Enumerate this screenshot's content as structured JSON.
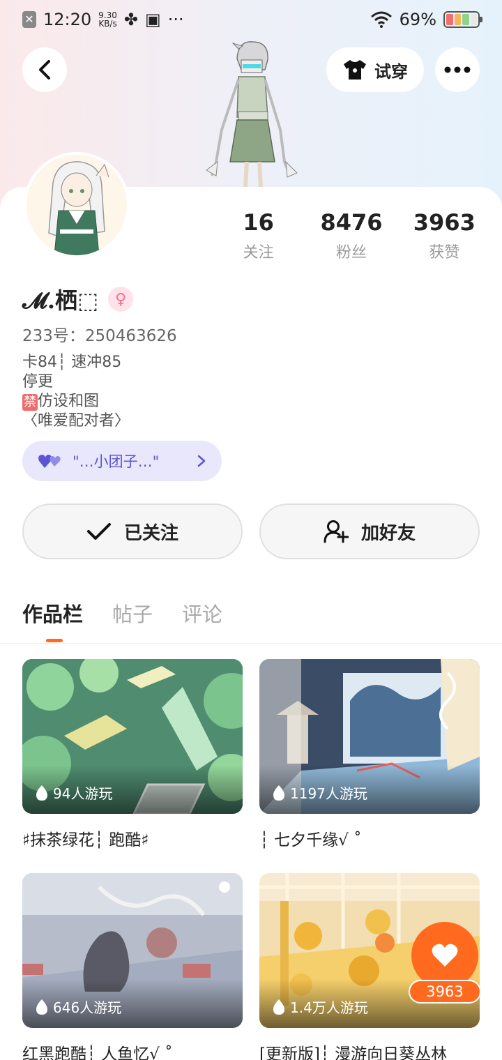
{
  "status_bar": {
    "time": "12:20",
    "net_speed_value": "9.30",
    "net_speed_unit": "KB/s",
    "more": "···",
    "battery": "69%"
  },
  "header": {
    "try_on_label": "试穿"
  },
  "profile": {
    "stats": [
      {
        "value": "16",
        "label": "关注"
      },
      {
        "value": "8476",
        "label": "粉丝"
      },
      {
        "value": "3963",
        "label": "获赞"
      }
    ],
    "username": "𝓜.栖⬚",
    "gender_icon": "♀",
    "uid": "233号：250463626",
    "bio": [
      "卡84┆ 速冲85",
      "停更",
      "仿设和图",
      "〈唯爱配对者〉"
    ],
    "ban_badge": "禁",
    "group_chip": "\"…小团子…\""
  },
  "actions": {
    "followed_label": "已关注",
    "add_friend_label": "加好友"
  },
  "tabs": [
    {
      "label": "作品栏",
      "active": true
    },
    {
      "label": "帖子",
      "active": false
    },
    {
      "label": "评论",
      "active": false
    }
  ],
  "works": [
    {
      "plays": "94人游玩",
      "title": "♯抹茶绿花┆ 跑酷♯"
    },
    {
      "plays": "1197人游玩",
      "title": "┆ 七夕千缘√ ˚"
    },
    {
      "plays": "646人游玩",
      "title": "红黑跑酷┆ 人鱼忆√ ˚"
    },
    {
      "plays": "1.4万人游玩",
      "title": "[更新版]┆ 漫游向日葵丛林"
    }
  ],
  "like_count": "3963",
  "colors": {
    "accent": "#ff6a1f",
    "chip_bg": "#e9e7fb",
    "chip_text": "#5b55d6"
  }
}
